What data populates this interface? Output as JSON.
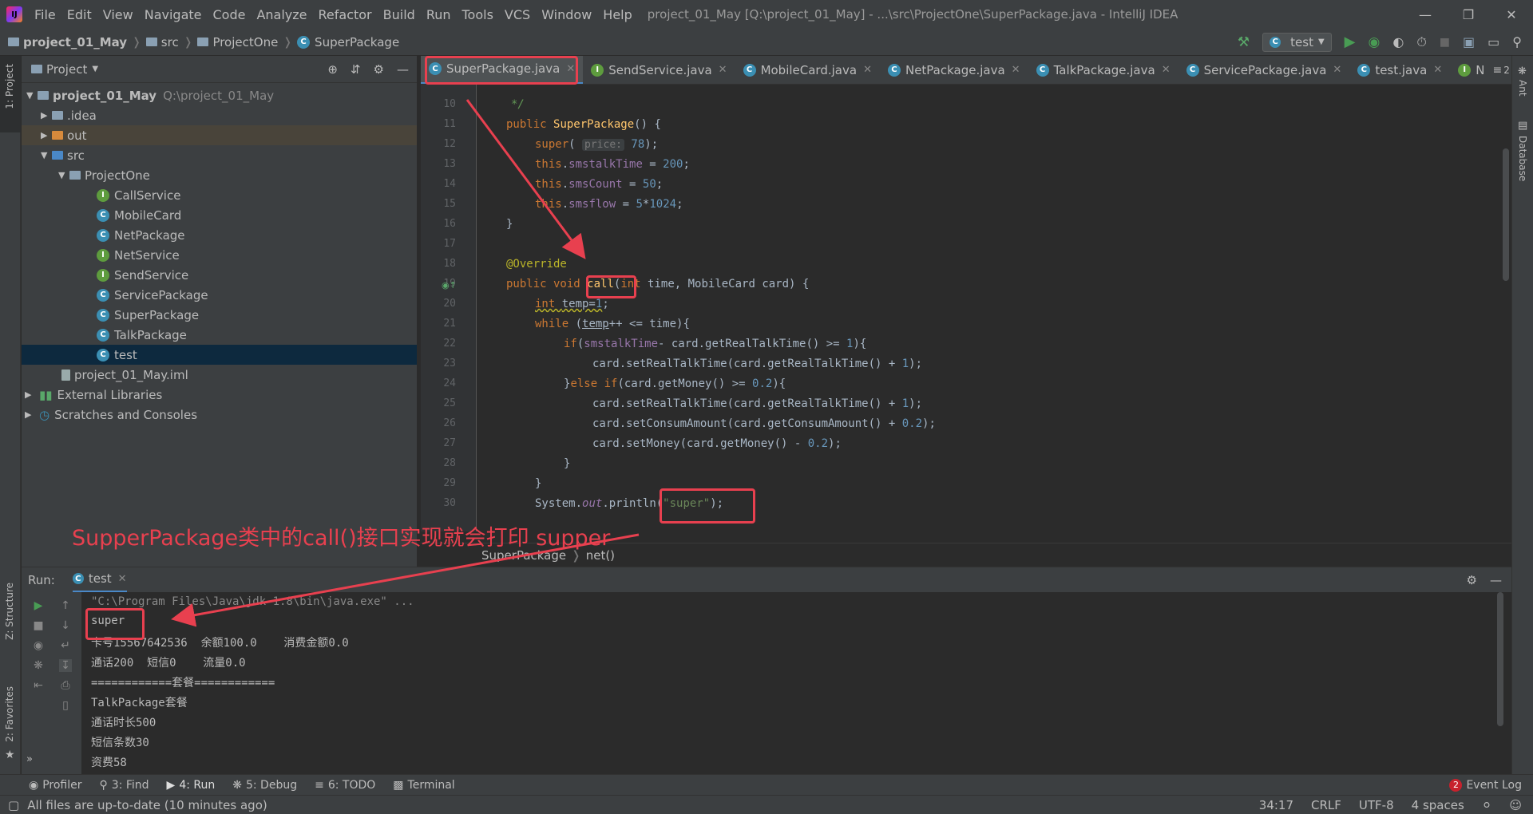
{
  "window": {
    "title": "project_01_May [Q:\\project_01_May] - ...\\src\\ProjectOne\\SuperPackage.java - IntelliJ IDEA",
    "menu": [
      "File",
      "Edit",
      "View",
      "Navigate",
      "Code",
      "Analyze",
      "Refactor",
      "Build",
      "Run",
      "Tools",
      "VCS",
      "Window",
      "Help"
    ]
  },
  "navbar": {
    "crumbs": [
      "project_01_May",
      "src",
      "ProjectOne",
      "SuperPackage"
    ],
    "run_config": "test"
  },
  "project_panel": {
    "title": "Project",
    "root": "project_01_May",
    "root_path": "Q:\\project_01_May",
    "items": {
      "idea": ".idea",
      "out": "out",
      "src": "src",
      "pkg": "ProjectOne",
      "files": [
        "CallService",
        "MobileCard",
        "NetPackage",
        "NetService",
        "SendService",
        "ServicePackage",
        "SuperPackage",
        "TalkPackage",
        "test"
      ],
      "iml": "project_01_May.iml",
      "ext": "External Libraries",
      "scratch": "Scratches and Consoles"
    }
  },
  "editor_tabs": [
    "SuperPackage.java",
    "SendService.java",
    "MobileCard.java",
    "NetPackage.java",
    "TalkPackage.java",
    "ServicePackage.java",
    "test.java",
    "N"
  ],
  "tab_overflow": "2",
  "code": {
    "line_numbers": [
      "10",
      "11",
      "12",
      "13",
      "14",
      "15",
      "16",
      "17",
      "18",
      "19",
      "20",
      "21",
      "22",
      "23",
      "24",
      "25",
      "26",
      "27",
      "28",
      "29",
      "30"
    ],
    "top_comment": "*/",
    "price_hint": "price:"
  },
  "editor_breadcrumb": [
    "SuperPackage",
    "net()"
  ],
  "left_strip": {
    "project": "1: Project",
    "structure": "Z: Structure",
    "favorites": "2: Favorites"
  },
  "right_strip": {
    "ant": "Ant",
    "database": "Database"
  },
  "run_panel": {
    "label": "Run:",
    "tab": "test",
    "lines": [
      "\"C:\\Program Files\\Java\\jdk-1.8\\bin\\java.exe\" ...",
      "super",
      "卡号15567642536  余额100.0    消费金额0.0",
      "通话200  短信0    流量0.0",
      "============套餐============",
      "TalkPackage套餐",
      "通话时长500",
      "短信条数30",
      "资费58"
    ]
  },
  "bottom_tools": [
    "Profiler",
    "3: Find",
    "4: Run",
    "5: Debug",
    "6: TODO",
    "Terminal"
  ],
  "event_log": {
    "count": "2",
    "label": "Event Log"
  },
  "status": {
    "message": "All files are up-to-date (10 minutes ago)",
    "position": "34:17",
    "line_sep": "CRLF",
    "encoding": "UTF-8",
    "indent": "4 spaces"
  },
  "annotation": {
    "text": "SupperPackage类中的call()接口实现就会打印 supper",
    "color": "#e8404f"
  }
}
